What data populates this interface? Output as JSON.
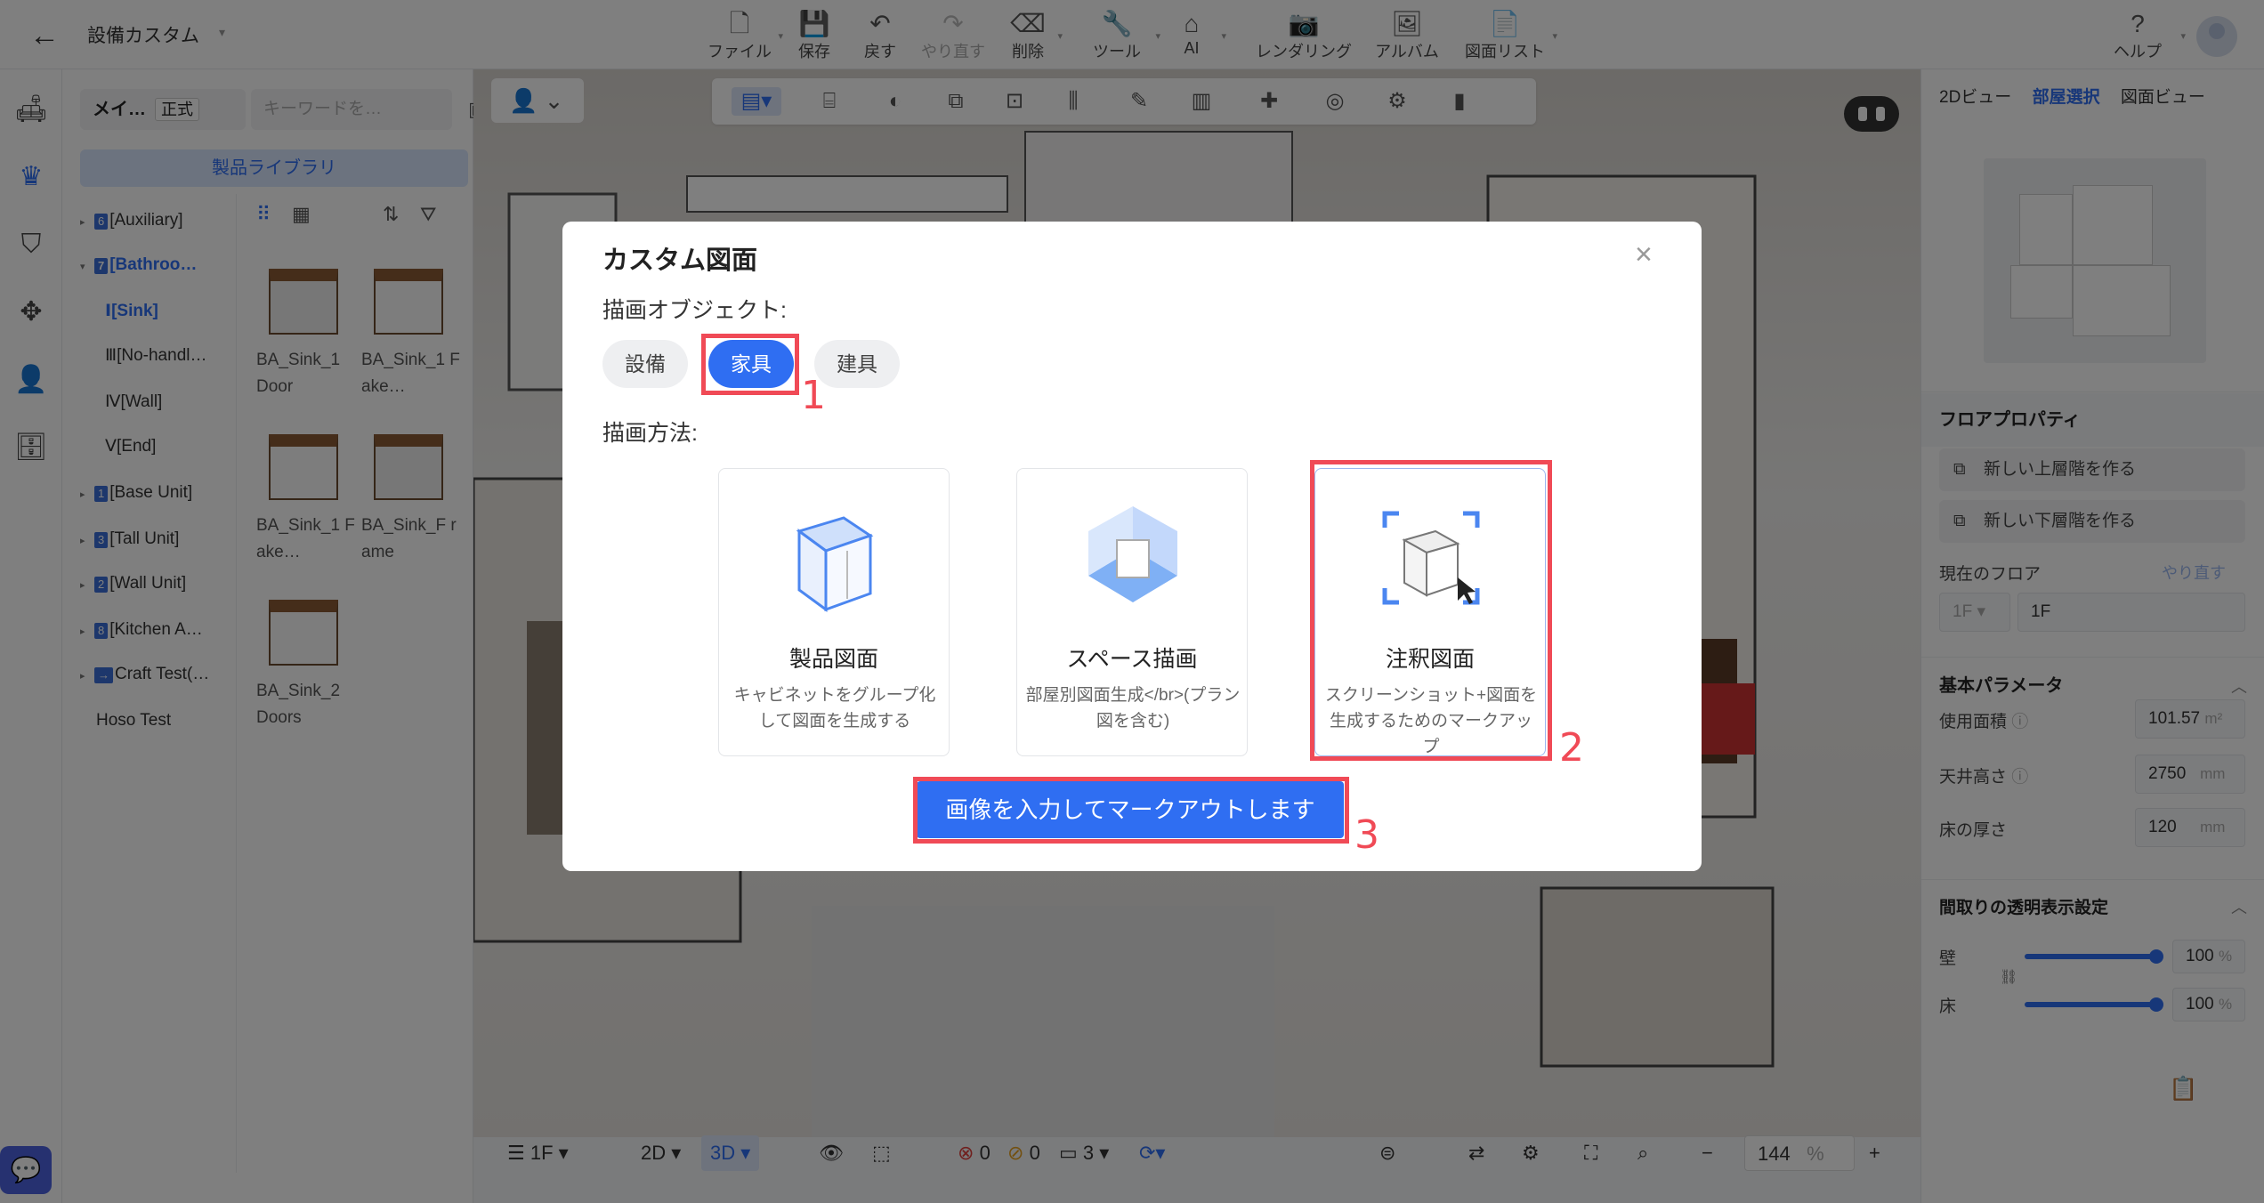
{
  "header": {
    "title": "設備カスタム",
    "menu": [
      {
        "label": "ファイル",
        "icon": "file-icon"
      },
      {
        "label": "保存",
        "icon": "save-icon"
      },
      {
        "label": "戻す",
        "icon": "undo-icon"
      },
      {
        "label": "やり直す",
        "icon": "redo-icon"
      },
      {
        "label": "削除",
        "icon": "eraser-icon"
      },
      {
        "label": "ツール",
        "icon": "wrench-icon"
      },
      {
        "label": "AI",
        "icon": "ai-house-icon"
      },
      {
        "label": "レンダリング",
        "icon": "camera-icon"
      },
      {
        "label": "アルバム",
        "icon": "album-icon"
      },
      {
        "label": "図面リスト",
        "icon": "drawing-list-icon"
      }
    ],
    "help": "ヘルプ"
  },
  "library": {
    "tab": "メイ…",
    "badge": "正式",
    "search_placeholder": "キーワードを…",
    "button": "製品ライブラリ",
    "tree": [
      {
        "num": "6",
        "label": "[Auxiliary]"
      },
      {
        "num": "7",
        "label": "[Bathroo…"
      },
      {
        "label": "Ⅰ[Sink]"
      },
      {
        "label": "Ⅲ[No-handl…"
      },
      {
        "label": "Ⅳ[Wall]"
      },
      {
        "label": "Ⅴ[End]"
      },
      {
        "num": "1",
        "label": "[Base Unit]"
      },
      {
        "num": "3",
        "label": "[Tall Unit]"
      },
      {
        "num": "2",
        "label": "[Wall Unit]"
      },
      {
        "num": "8",
        "label": "[Kitchen A…"
      },
      {
        "num": "→",
        "label": "Craft Test(…"
      },
      {
        "label": "Hoso Test"
      }
    ],
    "products": [
      {
        "label": "BA_Sink_1 Door"
      },
      {
        "label": "BA_Sink_1 Fake…"
      },
      {
        "label": "BA_Sink_1 Fake…"
      },
      {
        "label": "BA_Sink_F rame"
      },
      {
        "label": "BA_Sink_2 Doors"
      }
    ]
  },
  "bottombar": {
    "floor": "1F",
    "view2d": "2D",
    "view3d": "3D",
    "errors": "0",
    "warnings": "0",
    "count": "3",
    "zoom": "144",
    "zoom_unit": "%"
  },
  "rightpanel": {
    "tabs": [
      "2Dビュー",
      "部屋選択",
      "図面ビュー"
    ],
    "floor_props_title": "フロアプロパティ",
    "new_upper": "新しい上層階を作る",
    "new_lower": "新しい下層階を作る",
    "current_floor_label": "現在のフロア",
    "redo": "やり直す",
    "floor_select": "1F",
    "floor_name": "1F",
    "basic_params": "基本パラメータ",
    "area_label": "使用面積",
    "area_value": "101.57",
    "area_unit": "m²",
    "ceiling_label": "天井高さ",
    "ceiling_value": "2750",
    "ceiling_unit": "mm",
    "floor_thickness_label": "床の厚さ",
    "floor_thickness_value": "120",
    "floor_thickness_unit": "mm",
    "transparency_title": "間取りの透明表示設定",
    "wall_label": "壁",
    "wall_value": "100",
    "floor_label": "床",
    "floor_value": "100",
    "percent": "%"
  },
  "modal": {
    "title": "カスタム図面",
    "object_label": "描画オブジェクト:",
    "objects": [
      "設備",
      "家具",
      "建具"
    ],
    "selected_object": "家具",
    "method_label": "描画方法:",
    "methods": [
      {
        "name": "製品図面",
        "desc": "キャビネットをグループ化して図面を生成する"
      },
      {
        "name": "スペース描画",
        "desc": "部屋別図面生成</br>(プラン図を含む)"
      },
      {
        "name": "注釈図面",
        "desc": "スクリーンショット+図面を生成するためのマークアップ"
      }
    ],
    "selected_method": "注釈図面",
    "action_button": "画像を入力してマークアウトします",
    "markers": [
      "1",
      "2",
      "3"
    ]
  },
  "colors": {
    "accent": "#2f6ef2",
    "annotation_red": "#f04a56",
    "overlay": "rgba(0,0,0,0.5)"
  }
}
